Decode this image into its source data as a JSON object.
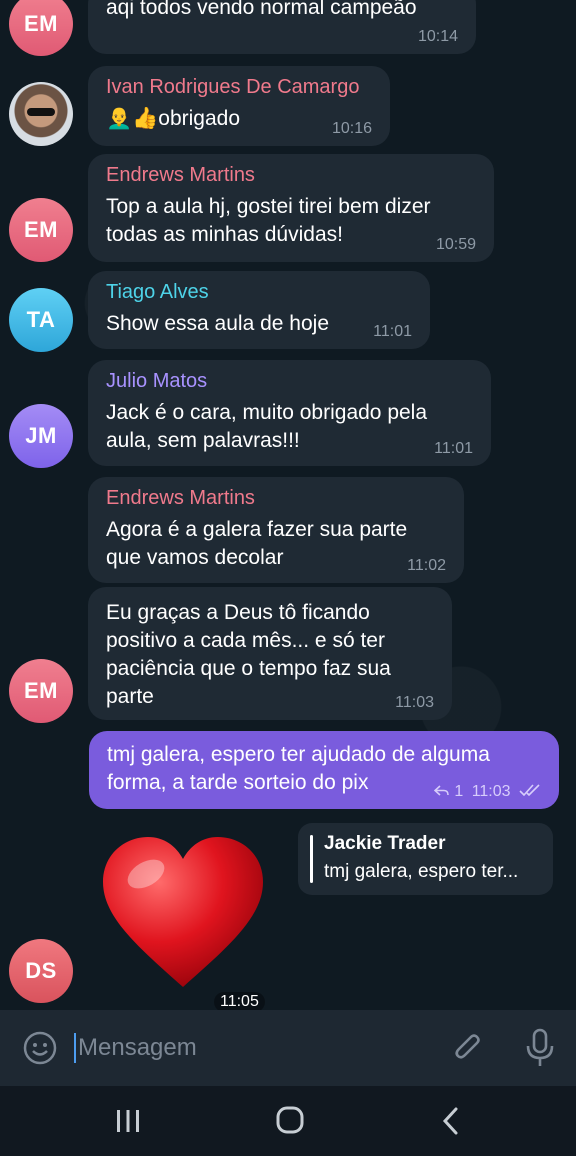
{
  "messages": [
    {
      "avatar": "EM",
      "text": "aqi todos vendo normal campeão",
      "time": "10:14"
    },
    {
      "sender": "Ivan Rodrigues De Camargo",
      "text": "👨‍🦲👍obrigado",
      "time": "10:16"
    },
    {
      "avatar": "EM",
      "sender": "Endrews Martins",
      "text": "Top a aula hj, gostei tirei bem dizer\ntodas as minhas dúvidas!",
      "time": "10:59"
    },
    {
      "avatar": "TA",
      "sender": "Tiago Alves",
      "text": "Show essa aula de hoje",
      "time": "11:01"
    },
    {
      "avatar": "JM",
      "sender": "Julio Matos",
      "text": "Jack é o cara, muito obrigado pela\naula, sem palavras!!!",
      "time": "11:01"
    },
    {
      "sender": "Endrews Martins",
      "text": "Agora é a galera fazer sua parte\nque vamos decolar",
      "time": "11:02"
    },
    {
      "avatar": "EM",
      "text": "Eu graças a Deus tô ficando\npositivo a cada mês... e só ter\npaciência que o tempo faz sua\nparte",
      "time": "11:03"
    },
    {
      "text": "tmj galera, espero ter ajudado de alguma\nforma, a tarde sorteio do pix",
      "time": "11:03",
      "reply_count": "1"
    },
    {
      "avatar": "DS",
      "time": "11:05"
    }
  ],
  "reply_preview": {
    "name": "Jackie Trader",
    "text": "tmj galera, espero ter..."
  },
  "input": {
    "placeholder": "Mensagem"
  },
  "colors": {
    "outgoing": "#7a5cdd",
    "incoming": "#1f2a34",
    "accent": "#4d9df0"
  }
}
